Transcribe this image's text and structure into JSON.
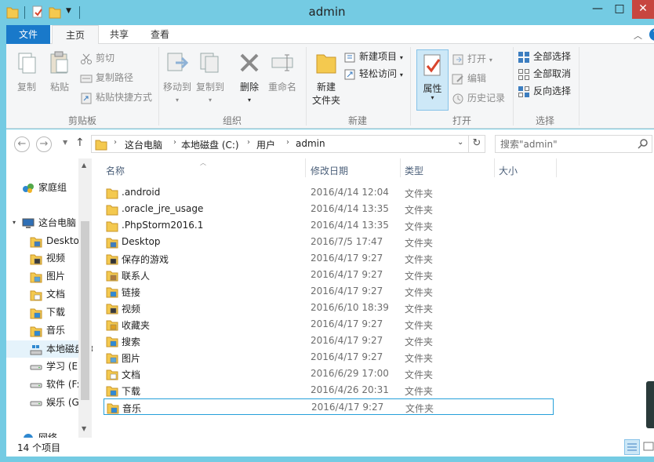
{
  "window": {
    "title": "admin",
    "controls": {
      "minimize": "—",
      "maximize": "□",
      "close": "✕"
    }
  },
  "tabs": {
    "file": "文件",
    "home": "主页",
    "share": "共享",
    "view": "查看"
  },
  "ribbon": {
    "clipboard": {
      "label": "剪贴板",
      "copy": "复制",
      "paste": "粘贴",
      "cut": "剪切",
      "copy_path": "复制路径",
      "paste_shortcut": "粘贴快捷方式"
    },
    "organize": {
      "label": "组织",
      "move_to": "移动到",
      "copy_to": "复制到",
      "delete": "删除",
      "rename": "重命名"
    },
    "new": {
      "label": "新建",
      "new_folder_line1": "新建",
      "new_folder_line2": "文件夹",
      "new_item": "新建项目",
      "easy_access": "轻松访问"
    },
    "open": {
      "label": "打开",
      "properties": "属性",
      "open": "打开",
      "edit": "编辑",
      "history": "历史记录"
    },
    "select": {
      "label": "选择",
      "select_all": "全部选择",
      "select_none": "全部取消",
      "invert": "反向选择"
    }
  },
  "address": {
    "crumbs": [
      "这台电脑",
      "本地磁盘 (C:)",
      "用户",
      "admin"
    ],
    "search_placeholder": "搜索\"admin\""
  },
  "navpane": {
    "items": [
      {
        "label": "家庭组",
        "icon": "homegroup-icon",
        "level": 0
      },
      {
        "label": "这台电脑",
        "icon": "computer-icon",
        "level": 0
      },
      {
        "label": "Desktop",
        "icon": "desktop-folder-icon",
        "level": 1
      },
      {
        "label": "视频",
        "icon": "videos-folder-icon",
        "level": 1
      },
      {
        "label": "图片",
        "icon": "pictures-folder-icon",
        "level": 1
      },
      {
        "label": "文档",
        "icon": "documents-folder-icon",
        "level": 1
      },
      {
        "label": "下载",
        "icon": "downloads-folder-icon",
        "level": 1
      },
      {
        "label": "音乐",
        "icon": "music-folder-icon",
        "level": 1
      },
      {
        "label": "本地磁盘 (C:)",
        "icon": "system-drive-icon",
        "level": 1
      },
      {
        "label": "学习 (E:)",
        "icon": "drive-icon",
        "level": 1
      },
      {
        "label": "软件 (F:)",
        "icon": "drive-icon",
        "level": 1
      },
      {
        "label": "娱乐 (G:)",
        "icon": "drive-icon",
        "level": 1
      },
      {
        "label": "网络",
        "icon": "network-icon",
        "level": 0
      }
    ]
  },
  "filelist": {
    "columns": {
      "name": "名称",
      "date": "修改日期",
      "type": "类型",
      "size": "大小"
    },
    "rows": [
      {
        "name": ".android",
        "date": "2016/4/14 12:04",
        "type": "文件夹",
        "icon": "folder-icon"
      },
      {
        "name": ".oracle_jre_usage",
        "date": "2016/4/14 13:35",
        "type": "文件夹",
        "icon": "folder-icon"
      },
      {
        "name": ".PhpStorm2016.1",
        "date": "2016/4/14 13:35",
        "type": "文件夹",
        "icon": "folder-icon"
      },
      {
        "name": "Desktop",
        "date": "2016/7/5 17:47",
        "type": "文件夹",
        "icon": "desktop-folder-icon"
      },
      {
        "name": "保存的游戏",
        "date": "2016/4/17 9:27",
        "type": "文件夹",
        "icon": "saved-games-folder-icon"
      },
      {
        "name": "联系人",
        "date": "2016/4/17 9:27",
        "type": "文件夹",
        "icon": "contacts-folder-icon"
      },
      {
        "name": "链接",
        "date": "2016/4/17 9:27",
        "type": "文件夹",
        "icon": "links-folder-icon"
      },
      {
        "name": "视频",
        "date": "2016/6/10 18:39",
        "type": "文件夹",
        "icon": "videos-folder-icon"
      },
      {
        "name": "收藏夹",
        "date": "2016/4/17 9:27",
        "type": "文件夹",
        "icon": "favorites-folder-icon"
      },
      {
        "name": "搜索",
        "date": "2016/4/17 9:27",
        "type": "文件夹",
        "icon": "searches-folder-icon"
      },
      {
        "name": "图片",
        "date": "2016/4/17 9:27",
        "type": "文件夹",
        "icon": "pictures-folder-icon"
      },
      {
        "name": "文档",
        "date": "2016/6/29 17:00",
        "type": "文件夹",
        "icon": "documents-folder-icon"
      },
      {
        "name": "下载",
        "date": "2016/4/26 20:31",
        "type": "文件夹",
        "icon": "downloads-folder-icon"
      },
      {
        "name": "音乐",
        "date": "2016/4/17 9:27",
        "type": "文件夹",
        "icon": "music-folder-icon",
        "selected": true
      }
    ]
  },
  "status": {
    "item_count": "14 个项目"
  },
  "colors": {
    "frame": "#74cbe3",
    "file_tab": "#1979ca",
    "selection_border": "#26a0da",
    "folder_yellow": "#f4c94f"
  }
}
